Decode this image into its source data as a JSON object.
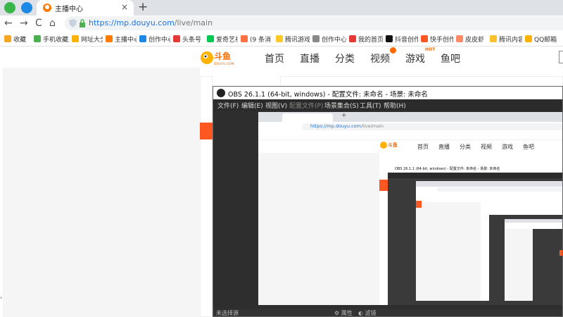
{
  "browser": {
    "tab_title": "主播中心",
    "tab_close": "×",
    "new_tab": "+",
    "url_host": "https://mp.douyu.com",
    "url_path": "/live/main",
    "nav": {
      "back": "←",
      "forward": "→",
      "reload": "C",
      "home": "⌂"
    }
  },
  "bookmarks": [
    {
      "label": "收藏",
      "color": "#f5a623"
    },
    {
      "label": "手机收藏夹",
      "color": "#4caf50"
    },
    {
      "label": "网址大全",
      "color": "#ffb300"
    },
    {
      "label": "主播中心",
      "color": "#ff7a00"
    },
    {
      "label": "创作中心",
      "color": "#1e88e5"
    },
    {
      "label": "头条号",
      "color": "#e53935"
    },
    {
      "label": "爱奇艺视",
      "color": "#00c853"
    },
    {
      "label": "(9 条消",
      "color": "#ff7043"
    },
    {
      "label": "腾讯游戏",
      "color": "#ffca28"
    },
    {
      "label": "创作中心",
      "color": "#888888"
    },
    {
      "label": "我的首页",
      "color": "#e53935"
    },
    {
      "label": "抖音创作",
      "color": "#111111"
    },
    {
      "label": "快手创作",
      "color": "#ff5722"
    },
    {
      "label": "皮皮虾",
      "color": "#ff8a65"
    },
    {
      "label": "腾讯内容",
      "color": "#fbc02d"
    },
    {
      "label": "QQ邮箱",
      "color": "#ffb300"
    }
  ],
  "site": {
    "logo_text": "斗鱼",
    "logo_sub": "DOUYU.COM",
    "nav": [
      "首页",
      "直播",
      "分类",
      "视频",
      "游戏",
      "鱼吧"
    ],
    "hot_label": "HOT"
  },
  "obs": {
    "title": "OBS 26.1.1 (64-bit, windows) - 配置文件: 未命名 - 场景: 未命名",
    "menu": [
      {
        "label": "文件(F)",
        "disabled": false
      },
      {
        "label": "编辑(E)",
        "disabled": false
      },
      {
        "label": "视图(V)",
        "disabled": false
      },
      {
        "label": "配置文件(P)",
        "disabled": true
      },
      {
        "label": "场景集合(S)",
        "disabled": false
      },
      {
        "label": "工具(T)",
        "disabled": false
      },
      {
        "label": "帮助(H)",
        "disabled": false
      }
    ],
    "bottom_left": "未选择源",
    "bottom_props": "属性",
    "bottom_filters": "滤镜"
  },
  "colors": {
    "accent_orange": "#ff5722",
    "douyu_orange": "#ff6a00",
    "link_blue": "#1a73e8"
  }
}
